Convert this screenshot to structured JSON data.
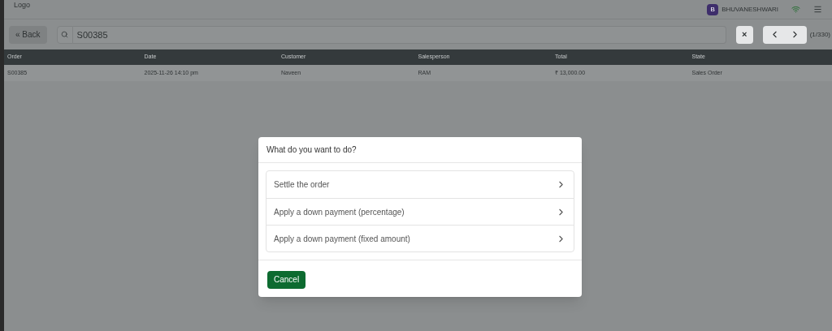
{
  "header": {
    "logo": "Logo",
    "user_initial": "B",
    "user_name": "BHUVANESHWARI"
  },
  "toolbar": {
    "back": "« Back",
    "search_value": "S00385",
    "clear": "×",
    "pager": "(1/330)"
  },
  "table": {
    "columns": [
      "Order",
      "Date",
      "Customer",
      "Salesperson",
      "Total",
      "State"
    ],
    "rows": [
      [
        "S00385",
        "2025-11-26 14:10 pm",
        "Naveen",
        "RAM",
        "₹ 13,000.00",
        "Sales Order"
      ]
    ]
  },
  "dialog": {
    "title": "What do you want to do?",
    "options": [
      "Settle the order",
      "Apply a down payment (percentage)",
      "Apply a down payment (fixed amount)"
    ],
    "cancel": "Cancel"
  }
}
